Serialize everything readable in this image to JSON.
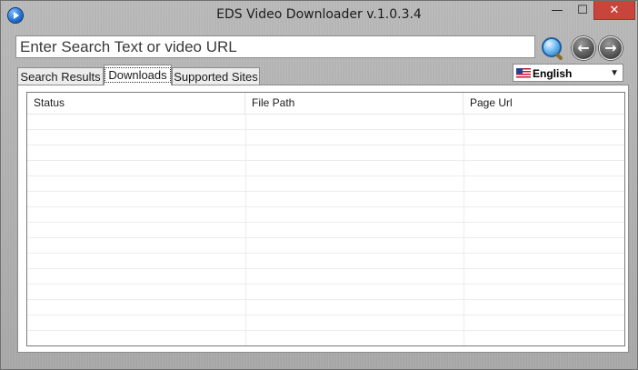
{
  "window": {
    "title": "EDS Video Downloader v.1.0.3.4",
    "controls": {
      "minimize": "—",
      "maximize": "☐",
      "close": "✕"
    }
  },
  "search": {
    "placeholder": "Enter Search Text or video URL",
    "value": ""
  },
  "nav": {
    "back": "←",
    "forward": "→"
  },
  "tabs": [
    {
      "label": "Search Results"
    },
    {
      "label": "Downloads",
      "selected": true
    },
    {
      "label": "Supported Sites"
    }
  ],
  "language": {
    "selected": "English",
    "flag_icon": "us-flag-icon"
  },
  "downloads_table": {
    "columns": [
      "Status",
      "File Path",
      "Page Url"
    ],
    "rows": []
  },
  "colors": {
    "close_button": "#c7453a",
    "panel": "#ffffff",
    "chrome": "#a8a8a8"
  }
}
